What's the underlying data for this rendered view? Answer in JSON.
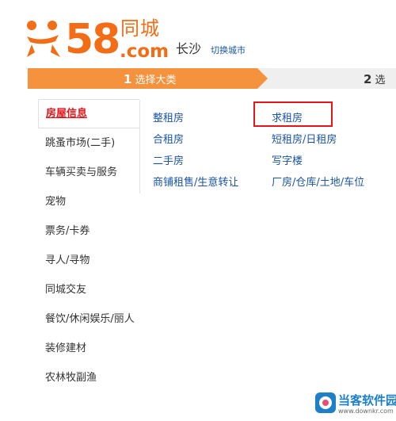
{
  "header": {
    "logo_number": "58",
    "logo_text_top": "同城",
    "logo_text_bottom": ".com",
    "city": "长沙",
    "switch_city_link": "切换城市"
  },
  "steps": [
    {
      "number": "1",
      "label": "选择大类",
      "state": "active"
    },
    {
      "number": "2",
      "label": "选",
      "state": "inactive"
    }
  ],
  "categories": [
    {
      "label": "房屋信息",
      "active": true
    },
    {
      "label": "跳蚤市场(二手)"
    },
    {
      "label": "车辆买卖与服务"
    },
    {
      "label": "宠物"
    },
    {
      "label": "票务/卡券"
    },
    {
      "label": "寻人/寻物"
    },
    {
      "label": "同城交友"
    },
    {
      "label": "餐饮/休闲娱乐/丽人"
    },
    {
      "label": "装修建材"
    },
    {
      "label": "农林牧副渔"
    }
  ],
  "subcategories": [
    [
      "整租房",
      "求租房"
    ],
    [
      "合租房",
      "短租房/日租房"
    ],
    [
      "二手房",
      "写字楼"
    ],
    [
      "商铺租售/生意转让",
      "厂房/仓库/土地/车位"
    ]
  ],
  "highlighted_subcategory": "求租房",
  "watermark": {
    "title": "当客软件园",
    "url": "www.downkr.com"
  },
  "colors": {
    "brand_orange": "#f26d16",
    "step_active": "#f5923e",
    "link_blue": "#1a55a5",
    "active_red": "#e4161c"
  }
}
